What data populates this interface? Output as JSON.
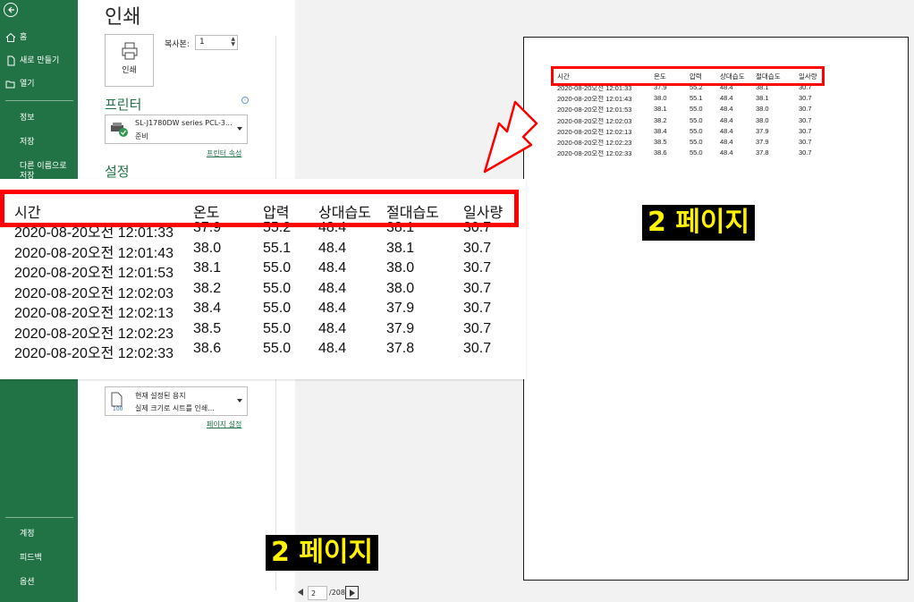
{
  "sidebar": {
    "home": "홈",
    "new": "새로 만들기",
    "open": "열기",
    "info": "정보",
    "save": "저장",
    "save_as": "다른 이름으로 저장",
    "account": "계정",
    "feedback": "피드백",
    "options": "옵션"
  },
  "print_panel": {
    "title": "인쇄",
    "print_button": "인쇄",
    "copies_label": "복사본:",
    "copies_value": "1",
    "printer_heading": "프린터",
    "printer_name": "SL-J1780DW series PCL-3...",
    "printer_status": "준비",
    "printer_properties": "프린터 속성",
    "settings_heading": "설정",
    "scaling_line1": "현재 설정된 용지",
    "scaling_line2": "실제 크기로 시트를 인쇄...",
    "page_setup": "페이지 설정"
  },
  "table": {
    "headers": [
      "시간",
      "온도",
      "압력",
      "상대습도",
      "절대습도",
      "일사량"
    ],
    "rows": [
      [
        "2020-08-20오전 12:01:33",
        "37.9",
        "55.2",
        "48.4",
        "38.1",
        "30.7"
      ],
      [
        "2020-08-20오전 12:01:43",
        "38.0",
        "55.1",
        "48.4",
        "38.1",
        "30.7"
      ],
      [
        "2020-08-20오전 12:01:53",
        "38.1",
        "55.0",
        "48.4",
        "38.0",
        "30.7"
      ],
      [
        "2020-08-20오전 12:02:03",
        "38.2",
        "55.0",
        "48.4",
        "38.0",
        "30.7"
      ],
      [
        "2020-08-20오전 12:02:13",
        "38.4",
        "55.0",
        "48.4",
        "37.9",
        "30.7"
      ],
      [
        "2020-08-20오전 12:02:23",
        "38.5",
        "55.0",
        "48.4",
        "37.9",
        "30.7"
      ],
      [
        "2020-08-20오전 12:02:33",
        "38.6",
        "55.0",
        "48.4",
        "37.8",
        "30.7"
      ]
    ]
  },
  "annotations": {
    "label_right": "2 페이지",
    "label_bottom": "2 페이지",
    "annotation_color": "#ff0000",
    "label_text_color": "#fff200"
  },
  "pager": {
    "current_page": "2",
    "total": "/208"
  },
  "colors": {
    "sidebar": "#217346",
    "preview_bg": "#f2f2f2"
  }
}
